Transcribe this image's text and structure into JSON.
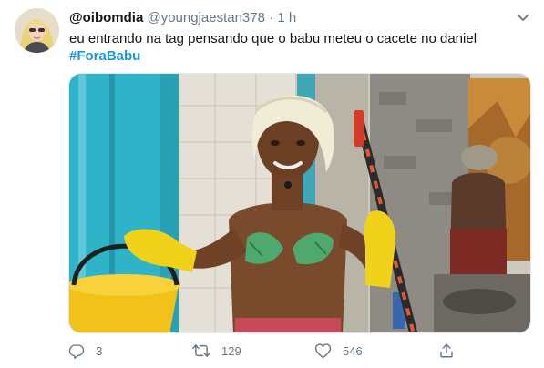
{
  "tweet": {
    "display_name": "@oibomdia",
    "handle": "@youngjaestan378",
    "separator": "·",
    "time": "1 h",
    "text": "eu entrando na tag pensando que o babu meteu o cacete no daniel",
    "hashtag": "#ForaBabu"
  },
  "actions": {
    "reply_count": "3",
    "retweet_count": "129",
    "like_count": "546"
  },
  "colors": {
    "accent": "#1b95e0",
    "secondary_text": "#657786",
    "primary_text": "#14171a"
  }
}
